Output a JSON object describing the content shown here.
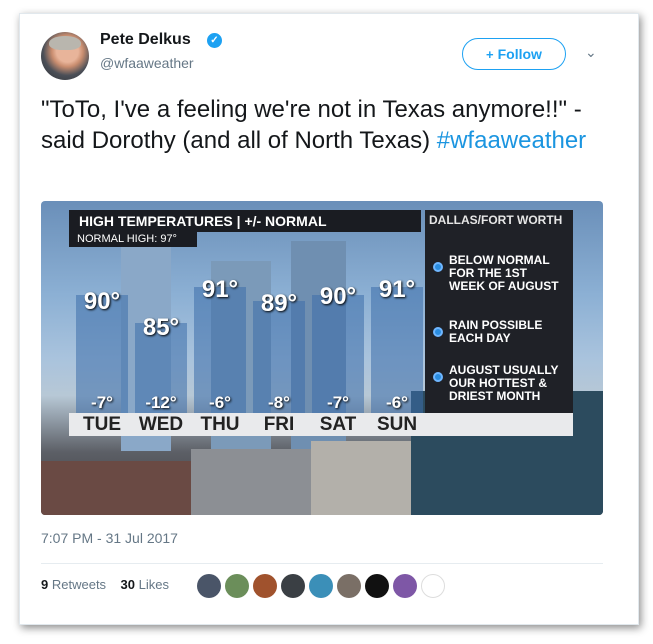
{
  "author": {
    "name": "Pete Delkus",
    "handle": "@wfaaweather",
    "verified_glyph": "✓"
  },
  "follow": {
    "icon": "+",
    "label": "Follow"
  },
  "more": {
    "icon": "chevron-down"
  },
  "tweet": {
    "text": "\"ToTo, I've a feeling we're not in Texas anymore!!\" - said Dorothy (and all of North Texas) ",
    "hashtag": "#wfaaweather"
  },
  "graphic": {
    "title": "HIGH TEMPERATURES | +/- NORMAL",
    "subtitle": "NORMAL HIGH: 97°",
    "location": "DALLAS/FORT WORTH",
    "notes": [
      "BELOW NORMAL FOR THE 1ST WEEK OF AUGUST",
      "RAIN POSSIBLE EACH DAY",
      "AUGUST USUALLY OUR HOTTEST & DRIEST MONTH"
    ],
    "days": [
      {
        "day": "TUE",
        "temp": "90°",
        "diff": "-7°"
      },
      {
        "day": "WED",
        "temp": "85°",
        "diff": "-12°"
      },
      {
        "day": "THU",
        "temp": "91°",
        "diff": "-6°"
      },
      {
        "day": "FRI",
        "temp": "89°",
        "diff": "-8°"
      },
      {
        "day": "SAT",
        "temp": "90°",
        "diff": "-7°"
      },
      {
        "day": "SUN",
        "temp": "91°",
        "diff": "-6°"
      }
    ]
  },
  "timestamp": "7:07 PM - 31 Jul 2017",
  "stats": {
    "retweets_count": "9",
    "retweets_label": "Retweets",
    "likes_count": "30",
    "likes_label": "Likes"
  },
  "colors": {
    "link": "#1b95e0",
    "follow": "#1da1f2",
    "muted": "#657786"
  }
}
